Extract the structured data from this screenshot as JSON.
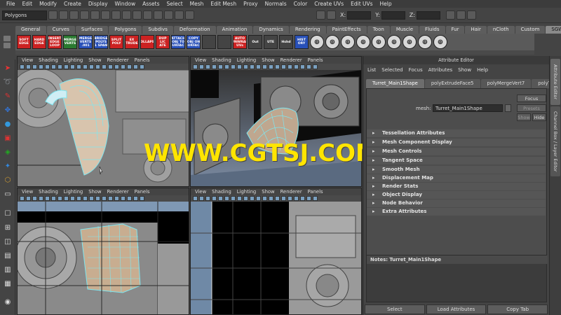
{
  "menu": [
    "File",
    "Edit",
    "Modify",
    "Create",
    "Display",
    "Window",
    "Assets",
    "Select",
    "Mesh",
    "Edit Mesh",
    "Proxy",
    "Normals",
    "Color",
    "Create UVs",
    "Edit UVs",
    "Help"
  ],
  "status": {
    "mode": "Polygons",
    "x_label": "X:",
    "y_label": "Y:",
    "z_label": "Z:"
  },
  "shelf_tabs": [
    "General",
    "Curves",
    "Surfaces",
    "Polygons",
    "Subdivs",
    "Deformation",
    "Animation",
    "Dynamics",
    "Rendering",
    "PaintEffects",
    "Toon",
    "Muscle",
    "Fluids",
    "Fur",
    "Hair",
    "nCloth",
    "Custom",
    "SGW"
  ],
  "shelf_active": "SGW",
  "shelf_buttons": [
    {
      "label": "SOFT EDGE",
      "color": "red"
    },
    {
      "label": "HARD EDGE",
      "color": "red"
    },
    {
      "label": "INSERT EDGE LOOP",
      "color": "red"
    },
    {
      "label": "MERGE VERTS",
      "color": "green"
    },
    {
      "label": "MERGE VERTS .001",
      "color": "blue"
    },
    {
      "label": "BRIDGE POLYS 1 SPAN",
      "color": "blue"
    },
    {
      "label": "SPLIT POLY",
      "color": "red"
    },
    {
      "label": "EX TRUDE",
      "color": "red"
    },
    {
      "label": "COLLAPSE",
      "color": "red"
    },
    {
      "label": "DUP LIC ATE",
      "color": "red"
    },
    {
      "label": "ATTACH OBJ TO SURFACE",
      "color": "blue"
    },
    {
      "label": "COPY OBJ ON SURFACE",
      "color": "blue"
    },
    {
      "label": "",
      "color": "grey"
    },
    {
      "label": "",
      "color": "grey"
    },
    {
      "label": "AUTO UNWRAP UVs",
      "color": "red"
    },
    {
      "label": "Out",
      "color": "grey"
    },
    {
      "label": "UTE",
      "color": "grey"
    },
    {
      "label": "Hshd",
      "color": "grey"
    },
    {
      "label": "HIST ORY",
      "color": "blue"
    }
  ],
  "viewport_menu": [
    "View",
    "Shading",
    "Lighting",
    "Show",
    "Renderer",
    "Panels"
  ],
  "attribute_editor": {
    "title": "Attribute Editor",
    "menu": [
      "List",
      "Selected",
      "Focus",
      "Attributes",
      "Show",
      "Help"
    ],
    "tabs": [
      "Turret_Main1Shape",
      "polyExtrudeFace5",
      "polyMergeVert7",
      "polyTweak"
    ],
    "active_tab": "Turret_Main1Shape",
    "mesh_label": "mesh:",
    "mesh_value": "Turret_Main1Shape",
    "focus_button": "Focus",
    "presets_button": "Presets",
    "show_button": "Show",
    "hide_button": "Hide",
    "sections": [
      "Tessellation Attributes",
      "Mesh Component Display",
      "Mesh Controls",
      "Tangent Space",
      "Smooth Mesh",
      "Displacement Map",
      "Render Stats",
      "Object Display",
      "Node Behavior",
      "Extra Attributes"
    ],
    "notes_title": "Notes: Turret_Main1Shape",
    "buttons": [
      "Select",
      "Load Attributes",
      "Copy Tab"
    ]
  },
  "side_tabs": [
    "Attribute Editor",
    "Channel Box / Layer Editor"
  ],
  "watermark": "WWW.CGTSJ.COM",
  "colors": {
    "accent": "#5ad0e0",
    "wire": "#7ee6f0",
    "watermark": "#ffe500"
  }
}
